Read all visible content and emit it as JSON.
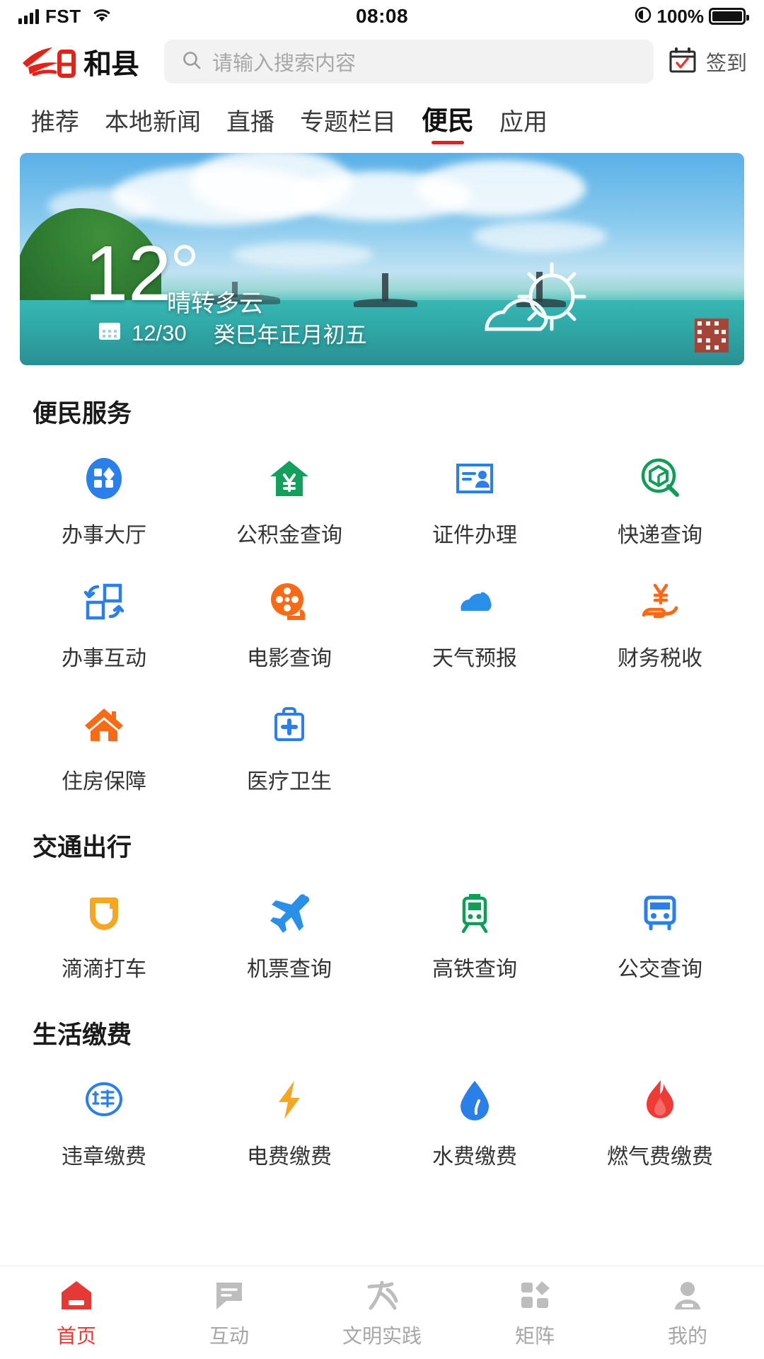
{
  "statusbar": {
    "carrier": "FST",
    "time": "08:08",
    "battery_pct": "100%",
    "signal_icon": "signal-bars-icon",
    "wifi_icon": "wifi-icon",
    "battery_icon": "battery-full-icon",
    "location_icon": "location-arrow-icon"
  },
  "header": {
    "logo_red": "今日",
    "logo_black": "和县",
    "search_placeholder": "请输入搜索内容",
    "search_value": "",
    "search_icon": "search-icon",
    "signin_label": "签到",
    "signin_icon": "calendar-check-icon"
  },
  "tabs": [
    {
      "label": "推荐",
      "active": false
    },
    {
      "label": "本地新闻",
      "active": false
    },
    {
      "label": "直播",
      "active": false
    },
    {
      "label": "专题栏目",
      "active": false
    },
    {
      "label": "便民",
      "active": true
    },
    {
      "label": "应用",
      "active": false
    }
  ],
  "weather": {
    "temperature": "12",
    "degree_symbol": "°",
    "condition": "晴转多云",
    "date": "12/30",
    "lunar_date": "癸巳年正月初五",
    "calendar_icon": "calendar-icon",
    "condition_icon": "sun-behind-cloud-icon",
    "qr_icon": "qr-code-icon"
  },
  "sections": [
    {
      "title": "便民服务",
      "items": [
        {
          "label": "办事大厅",
          "icon": "service-hall-icon",
          "color": "#2a7fe8"
        },
        {
          "label": "公积金查询",
          "icon": "housing-fund-icon",
          "color": "#12a05c"
        },
        {
          "label": "证件办理",
          "icon": "id-card-icon",
          "color": "#2a7fe8"
        },
        {
          "label": "快递查询",
          "icon": "package-search-icon",
          "color": "#0f9d58"
        },
        {
          "label": "办事互动",
          "icon": "exchange-arrows-icon",
          "color": "#2a7fe8"
        },
        {
          "label": "电影查询",
          "icon": "film-reel-icon",
          "color": "#f96a16"
        },
        {
          "label": "天气预报",
          "icon": "cloud-icon",
          "color": "#2a8fe8"
        },
        {
          "label": "财务税收",
          "icon": "yuan-in-hand-icon",
          "color": "#f96a16"
        },
        {
          "label": "住房保障",
          "icon": "home-icon",
          "color": "#f96a16"
        },
        {
          "label": "医疗卫生",
          "icon": "medical-kit-icon",
          "color": "#2a7fe8"
        }
      ]
    },
    {
      "title": "交通出行",
      "items": [
        {
          "label": "滴滴打车",
          "icon": "didi-icon",
          "color": "#f5a623"
        },
        {
          "label": "机票查询",
          "icon": "airplane-icon",
          "color": "#2a8fe8"
        },
        {
          "label": "高铁查询",
          "icon": "train-icon",
          "color": "#0f9d58"
        },
        {
          "label": "公交查询",
          "icon": "bus-icon",
          "color": "#2a7fe8"
        }
      ]
    },
    {
      "title": "生活缴费",
      "items": [
        {
          "label": "违章缴费",
          "icon": "traffic-violation-icon",
          "color": "#2a7fe8"
        },
        {
          "label": "电费缴费",
          "icon": "lightning-bolt-icon",
          "color": "#f5a623"
        },
        {
          "label": "水费缴费",
          "icon": "water-drop-icon",
          "color": "#2a7fe8"
        },
        {
          "label": "燃气费缴费",
          "icon": "flame-icon",
          "color": "#ef3b36"
        }
      ]
    }
  ],
  "tabbar": [
    {
      "label": "首页",
      "icon": "home-nav-icon",
      "active": true
    },
    {
      "label": "互动",
      "icon": "chat-icon",
      "active": false
    },
    {
      "label": "文明实践",
      "icon": "civil-icon",
      "active": false
    },
    {
      "label": "矩阵",
      "icon": "grid-icon",
      "active": false
    },
    {
      "label": "我的",
      "icon": "user-icon",
      "active": false
    }
  ],
  "colors": {
    "accent_red": "#e02020",
    "nav_active": "#e53935",
    "logo_red": "#e2231a",
    "search_bg": "#f2f2f2"
  }
}
